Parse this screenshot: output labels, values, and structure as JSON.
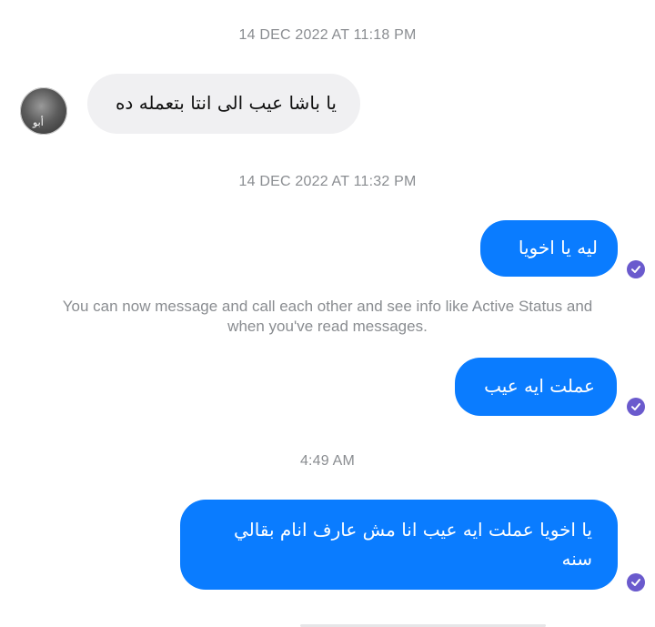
{
  "conversation": {
    "timestamps": [
      "14 DEC 2022 AT 11:18 PM",
      "14 DEC 2022 AT 11:32 PM",
      "4:49 AM"
    ],
    "avatar_label": "أبو",
    "messages": {
      "m1": "يا باشا عيب الى انتا بتعمله ده",
      "m2": "ليه يا اخويا",
      "m3": "عملت ايه عيب",
      "m4": "يا اخويا عملت ايه عيب انا مش عارف انام بقالي سنه"
    },
    "notice": "You can now message and call each other and see info like Active Status and when you've read messages.",
    "colors": {
      "outgoing": "#0a7cff",
      "incoming": "#f0f0f2",
      "seen": "#6a5acd"
    },
    "icons": {
      "seen": "check-circle-icon"
    }
  }
}
